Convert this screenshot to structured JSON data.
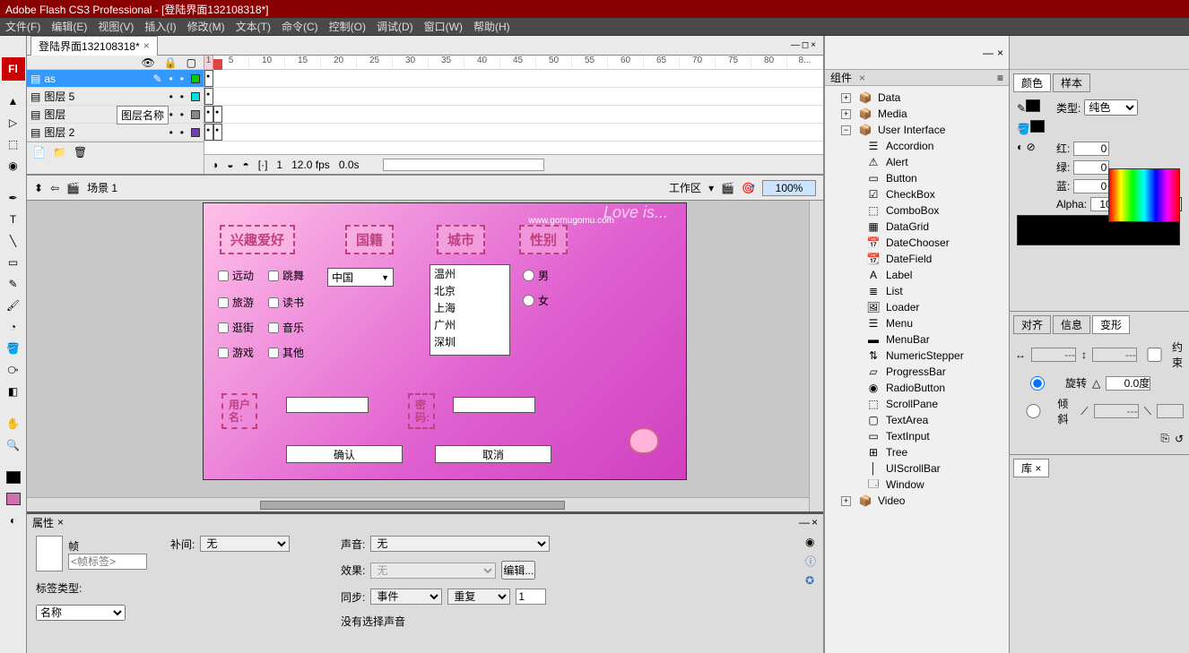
{
  "title_bar": "Adobe Flash CS3 Professional - [登陆界面132108318*]",
  "menu": {
    "file": "文件(F)",
    "edit": "编辑(E)",
    "view": "视图(V)",
    "insert": "插入(I)",
    "modify": "修改(M)",
    "text": "文本(T)",
    "commands": "命令(C)",
    "control": "控制(O)",
    "debug": "调试(D)",
    "window": "窗口(W)",
    "help": "帮助(H)"
  },
  "doc_tab": "登陆界面132108318*",
  "layers": {
    "tooltip": "图层名称",
    "items": [
      {
        "name": "as",
        "selected": true,
        "color": "#00cc00"
      },
      {
        "name": "图层 5",
        "selected": false,
        "color": "#00e0e0"
      },
      {
        "name": "图层",
        "selected": false,
        "color": "#888888"
      },
      {
        "name": "图层 2",
        "selected": false,
        "color": "#7040b0"
      }
    ]
  },
  "ruler": {
    "start": 1,
    "marks": [
      "5",
      "10",
      "15",
      "20",
      "25",
      "30",
      "35",
      "40",
      "45",
      "50",
      "55",
      "60",
      "65",
      "70",
      "75",
      "80",
      "8..."
    ]
  },
  "frames_footer": {
    "frame": "1",
    "fps": "12.0 fps",
    "time": "0.0s"
  },
  "scene": {
    "label": "场景 1",
    "work_area": "工作区",
    "zoom": "100%"
  },
  "stage": {
    "love": "Love is...",
    "url": "www.gomugomu.com",
    "sections": {
      "hobby": "兴趣爱好",
      "nation": "国籍",
      "city": "城市",
      "gender": "性别"
    },
    "hobbies": {
      "r1c1": "远动",
      "r1c2": "跳舞",
      "r2c1": "旅游",
      "r2c2": "读书",
      "r3c1": "逛街",
      "r3c2": "音乐",
      "r4c1": "游戏",
      "r4c2": "其他"
    },
    "nation_value": "中国",
    "cities": [
      "温州",
      "北京",
      "上海",
      "广州",
      "深圳"
    ],
    "gender": {
      "male": "男",
      "female": "女"
    },
    "user_label": "用户名:",
    "pass_label": "密码:",
    "ok": "确认",
    "cancel": "取消"
  },
  "components_panel": {
    "title": "组件",
    "folders": {
      "data": "Data",
      "media": "Media",
      "ui": "User Interface",
      "video": "Video"
    },
    "ui_items": [
      "Accordion",
      "Alert",
      "Button",
      "CheckBox",
      "ComboBox",
      "DataGrid",
      "DateChooser",
      "DateField",
      "Label",
      "List",
      "Loader",
      "Menu",
      "MenuBar",
      "NumericStepper",
      "ProgressBar",
      "RadioButton",
      "ScrollPane",
      "TextArea",
      "TextInput",
      "Tree",
      "UIScrollBar",
      "Window"
    ]
  },
  "color_panel": {
    "tab_color": "颜色",
    "tab_swatch": "样本",
    "type_label": "类型:",
    "type_value": "纯色",
    "r_label": "红:",
    "r_val": "0",
    "g_label": "绿:",
    "g_val": "0",
    "b_label": "蓝:",
    "b_val": "0",
    "alpha_label": "Alpha:",
    "alpha_val": "100%",
    "hex": "#000000"
  },
  "transform_panel": {
    "tabs": {
      "align": "对齐",
      "info": "信息",
      "transform": "变形"
    },
    "constrain": "约束",
    "rotate_label": "旋转",
    "skew_label": "倾斜",
    "rotate_val": "0.0度",
    "dash": "---"
  },
  "library_panel": {
    "tab": "库"
  },
  "properties": {
    "tab": "属性",
    "frame_label": "帧",
    "frame_tag_placeholder": "<帧标签>",
    "tween_label": "补间:",
    "tween_value": "无",
    "label_type_label": "标签类型:",
    "label_type_value": "名称",
    "sound_label": "声音:",
    "sound_value": "无",
    "effect_label": "效果:",
    "effect_value": "无",
    "edit_btn": "编辑...",
    "sync_label": "同步:",
    "sync_value": "事件",
    "repeat_value": "重复",
    "repeat_count": "1",
    "no_sound": "没有选择声音"
  }
}
